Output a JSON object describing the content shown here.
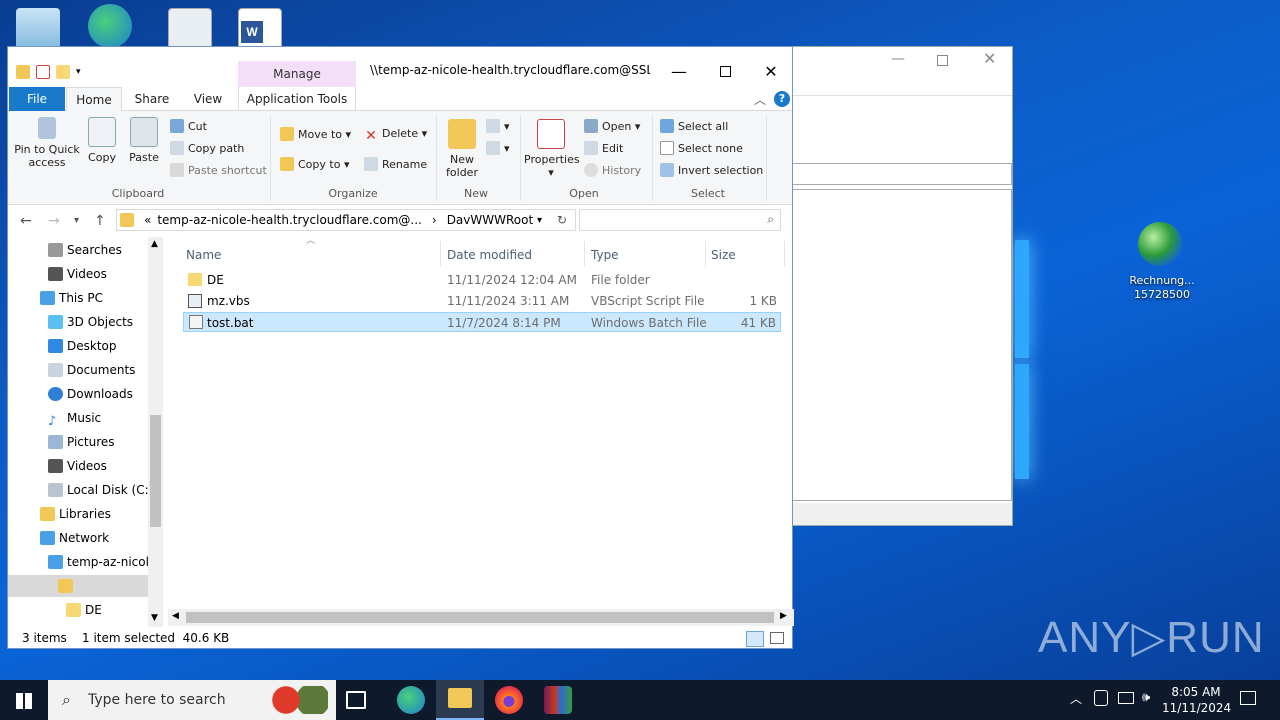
{
  "explorer": {
    "title": "\\\\temp-az-nicole-health.trycloudflare.com@SSL\\...",
    "manage_label": "Manage",
    "tabs": {
      "file": "File",
      "home": "Home",
      "share": "Share",
      "view": "View",
      "app_tools": "Application Tools"
    },
    "ribbon": {
      "clipboard": {
        "pin": "Pin to Quick",
        "pin2": "access",
        "copy": "Copy",
        "paste": "Paste",
        "cut": "Cut",
        "copy_path": "Copy path",
        "paste_shortcut": "Paste shortcut",
        "label": "Clipboard"
      },
      "organize": {
        "move_to": "Move to",
        "copy_to": "Copy to",
        "delete": "Delete",
        "rename": "Rename",
        "label": "Organize"
      },
      "new": {
        "new_folder": "New",
        "new_folder2": "folder",
        "label": "New"
      },
      "open": {
        "properties": "Properties",
        "open": "Open",
        "edit": "Edit",
        "history": "History",
        "label": "Open"
      },
      "select": {
        "select_all": "Select all",
        "select_none": "Select none",
        "invert": "Invert selection",
        "label": "Select"
      }
    },
    "address": {
      "prefix": "«",
      "path1": "temp-az-nicole-health.trycloudflare.com@...",
      "chevron": "›",
      "path2": "DavWWWRoot"
    },
    "nav": [
      "Searches",
      "Videos",
      "This PC",
      "3D Objects",
      "Desktop",
      "Documents",
      "Downloads",
      "Music",
      "Pictures",
      "Videos",
      "Local Disk (C:)",
      "Libraries",
      "Network",
      "temp-az-nicole",
      "",
      "DE"
    ],
    "columns": {
      "name": "Name",
      "date": "Date modified",
      "type": "Type",
      "size": "Size"
    },
    "files": [
      {
        "name": "DE",
        "date": "11/11/2024 12:04 AM",
        "type": "File folder",
        "size": ""
      },
      {
        "name": "mz.vbs",
        "date": "11/11/2024 3:11 AM",
        "type": "VBScript Script File",
        "size": "1 KB"
      },
      {
        "name": "tost.bat",
        "date": "11/7/2024 8:14 PM",
        "type": "Windows Batch File",
        "size": "41 KB"
      }
    ],
    "status": {
      "count": "3 items",
      "selected": "1 item selected  40.6 KB"
    }
  },
  "desktop": {
    "shortcut_label1": "Rechnung...",
    "shortcut_label2": "15728500"
  },
  "taskbar": {
    "search_placeholder": "Type here to search",
    "time": "8:05 AM",
    "date": "11/11/2024"
  },
  "watermark": "ANY▷RUN"
}
